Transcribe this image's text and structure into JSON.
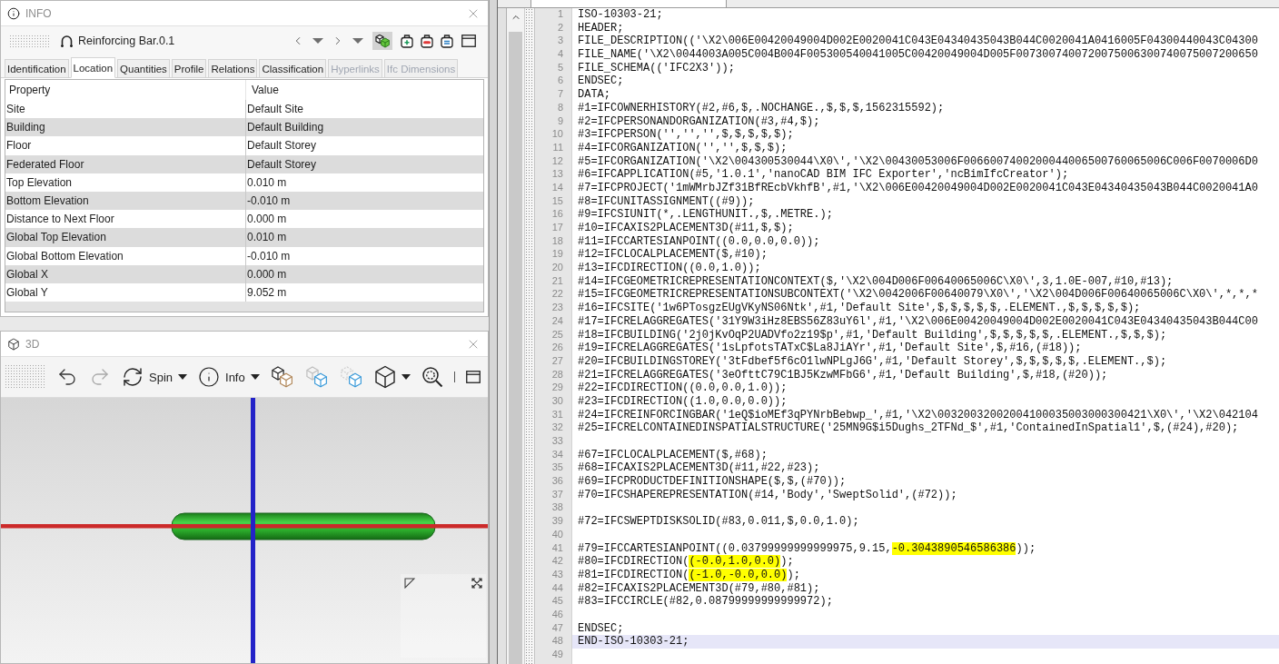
{
  "info_panel": {
    "title": "INFO",
    "object_name": "Reinforcing Bar.0.1",
    "toggle_on": true,
    "tabs": [
      {
        "label": "Identification",
        "selected": false,
        "disabled": false
      },
      {
        "label": "Location",
        "selected": true,
        "disabled": false
      },
      {
        "label": "Quantities",
        "selected": false,
        "disabled": false
      },
      {
        "label": "Profile",
        "selected": false,
        "disabled": false
      },
      {
        "label": "Relations",
        "selected": false,
        "disabled": false
      },
      {
        "label": "Classification",
        "selected": false,
        "disabled": false
      },
      {
        "label": "Hyperlinks",
        "selected": false,
        "disabled": true
      },
      {
        "label": "Ifc Dimensions",
        "selected": false,
        "disabled": true
      }
    ],
    "table": {
      "columns": [
        "Property",
        "Value"
      ],
      "rows": [
        {
          "property": "Site",
          "value": "Default Site"
        },
        {
          "property": "Building",
          "value": "Default Building"
        },
        {
          "property": "Floor",
          "value": "Default Storey"
        },
        {
          "property": "Federated Floor",
          "value": "Default Storey"
        },
        {
          "property": "Top Elevation",
          "value": "0.010 m"
        },
        {
          "property": "Bottom Elevation",
          "value": "-0.010 m"
        },
        {
          "property": "Distance to Next Floor",
          "value": "0.000 m"
        },
        {
          "property": "Global Top Elevation",
          "value": "0.010 m"
        },
        {
          "property": "Global Bottom Elevation",
          "value": "-0.010 m"
        },
        {
          "property": "Global X",
          "value": "0.000 m"
        },
        {
          "property": "Global Y",
          "value": "9.052 m"
        }
      ]
    }
  },
  "view_panel": {
    "title": "3D",
    "redo_disabled": true,
    "spin_label": "Spin",
    "info_label": "Info"
  },
  "editor": {
    "lines": [
      {
        "number": "1",
        "text": "ISO-10303-21;",
        "current": false
      },
      {
        "number": "2",
        "text": "HEADER;",
        "current": false
      },
      {
        "number": "3",
        "text": "FILE_DESCRIPTION(('\\X2\\006E00420049004D002E0020041C043E04340435043B044C0020041A0416005F04300440043C04300",
        "current": false
      },
      {
        "number": "4",
        "text": "FILE_NAME('\\X2\\0044003A005C004B004F005300540041005C00420049004D005F0073007400720075006300740075007200650",
        "current": false
      },
      {
        "number": "5",
        "text": "FILE_SCHEMA(('IFC2X3'));",
        "current": false
      },
      {
        "number": "6",
        "text": "ENDSEC;",
        "current": false
      },
      {
        "number": "7",
        "text": "DATA;",
        "current": false
      },
      {
        "number": "8",
        "text": "#1=IFCOWNERHISTORY(#2,#6,$,.NOCHANGE.,$,$,$,1562315592);",
        "current": false
      },
      {
        "number": "9",
        "text": "#2=IFCPERSONANDORGANIZATION(#3,#4,$);",
        "current": false
      },
      {
        "number": "10",
        "text": "#3=IFCPERSON('','','',$,$,$,$,$);",
        "current": false
      },
      {
        "number": "11",
        "text": "#4=IFCORGANIZATION('','',$,$,$);",
        "current": false
      },
      {
        "number": "12",
        "text": "#5=IFCORGANIZATION('\\X2\\004300530044\\X0\\','\\X2\\00430053006F0066007400200044006500760065006C006F0070006D0",
        "current": false
      },
      {
        "number": "13",
        "text": "#6=IFCAPPLICATION(#5,'1.0.1','nanoCAD BIM IFC Exporter','ncBimIfcCreator');",
        "current": false
      },
      {
        "number": "14",
        "text": "#7=IFCPROJECT('1mWMrbJZf31BfREcbVkhfB',#1,'\\X2\\006E00420049004D002E0020041C043E04340435043B044C0020041A0",
        "current": false
      },
      {
        "number": "15",
        "text": "#8=IFCUNITASSIGNMENT((#9));",
        "current": false
      },
      {
        "number": "16",
        "text": "#9=IFCSIUNIT(*,.LENGTHUNIT.,$,.METRE.);",
        "current": false
      },
      {
        "number": "17",
        "text": "#10=IFCAXIS2PLACEMENT3D(#11,$,$);",
        "current": false
      },
      {
        "number": "18",
        "text": "#11=IFCCARTESIANPOINT((0.0,0.0,0.0));",
        "current": false
      },
      {
        "number": "19",
        "text": "#12=IFCLOCALPLACEMENT($,#10);",
        "current": false
      },
      {
        "number": "20",
        "text": "#13=IFCDIRECTION((0.0,1.0));",
        "current": false
      },
      {
        "number": "21",
        "text": "#14=IFCGEOMETRICREPRESENTATIONCONTEXT($,'\\X2\\004D006F00640065006C\\X0\\',3,1.0E-007,#10,#13);",
        "current": false
      },
      {
        "number": "22",
        "text": "#15=IFCGEOMETRICREPRESENTATIONSUBCONTEXT('\\X2\\0042006F00640079\\X0\\','\\X2\\004D006F00640065006C\\X0\\',*,*,*",
        "current": false
      },
      {
        "number": "23",
        "text": "#16=IFCSITE('1w6PTosgzEUgVKyNS06Ntk',#1,'Default Site',$,$,$,$,$,.ELEMENT.,$,$,$,$,$);",
        "current": false
      },
      {
        "number": "24",
        "text": "#17=IFCRELAGGREGATES('31Y9W3iHz8EBS56Z83uY6l',#1,'\\X2\\006E00420049004D002E0020041C043E04340435043B044C00",
        "current": false
      },
      {
        "number": "25",
        "text": "#18=IFCBUILDING('2j0jKvOqP2UADVfo2z19$p',#1,'Default Building',$,$,$,$,$,.ELEMENT.,$,$,$);",
        "current": false
      },
      {
        "number": "26",
        "text": "#19=IFCRELAGGREGATES('1sLpfotsTATxC$La8JiAYr',#1,'Default Site',$,#16,(#18));",
        "current": false
      },
      {
        "number": "27",
        "text": "#20=IFCBUILDINGSTOREY('3tFdbef5f6cO1lwNPLgJ6G',#1,'Default Storey',$,$,$,$,$,.ELEMENT.,$);",
        "current": false
      },
      {
        "number": "28",
        "text": "#21=IFCRELAGGREGATES('3eOfttC79C1BJ5KzwMFbG6',#1,'Default Building',$,#18,(#20));",
        "current": false
      },
      {
        "number": "29",
        "text": "#22=IFCDIRECTION((0.0,0.0,1.0));",
        "current": false
      },
      {
        "number": "30",
        "text": "#23=IFCDIRECTION((1.0,0.0,0.0));",
        "current": false
      },
      {
        "number": "31",
        "text": "#24=IFCREINFORCINGBAR('1eQ$ioMEf3qPYNrbBebwp_',#1,'\\X2\\00320032002004100035003000300421\\X0\\','\\X2\\042104",
        "current": false
      },
      {
        "number": "32",
        "text": "#25=IFCRELCONTAINEDINSPATIALSTRUCTURE('25MN9G$i5Dughs_2TFNd_$',#1,'ContainedInSpatial1',$,(#24),#20);",
        "current": false
      },
      {
        "number": "33",
        "current": false
      },
      {
        "number": "34",
        "text": "#67=IFCLOCALPLACEMENT($,#68);",
        "current": false
      },
      {
        "number": "35",
        "text": "#68=IFCAXIS2PLACEMENT3D(#11,#22,#23);",
        "current": false
      },
      {
        "number": "36",
        "text": "#69=IFCPRODUCTDEFINITIONSHAPE($,$,(#70));",
        "current": false
      },
      {
        "number": "37",
        "text": "#70=IFCSHAPEREPRESENTATION(#14,'Body','SweptSolid',(#72));",
        "current": false
      },
      {
        "number": "38",
        "current": false
      },
      {
        "number": "39",
        "text": "#72=IFCSWEPTDISKSOLID(#83,0.011,$,0.0,1.0);",
        "current": false
      },
      {
        "number": "40",
        "current": false
      },
      {
        "number": "41",
        "segments": [
          {
            "text": "#79=IFCCARTESIANPOINT((0.03799999999999975,9.15,",
            "highlighted": false
          },
          {
            "text": "-0.3043890546586386",
            "highlighted": true
          },
          {
            "text": "));",
            "highlighted": false
          }
        ],
        "current": false
      },
      {
        "number": "42",
        "segments": [
          {
            "text": "#80=IFCDIRECTION(",
            "highlighted": false
          },
          {
            "text": "(-0.0,1.0,0.0)",
            "highlighted": true
          },
          {
            "text": ");",
            "highlighted": false
          }
        ],
        "current": false
      },
      {
        "number": "43",
        "segments": [
          {
            "text": "#81=IFCDIRECTION(",
            "highlighted": false
          },
          {
            "text": "(-1.0,-0.0,0.0)",
            "highlighted": true
          },
          {
            "text": ");",
            "highlighted": false
          }
        ],
        "current": false
      },
      {
        "number": "44",
        "text": "#82=IFCAXIS2PLACEMENT3D(#79,#80,#81);",
        "current": false
      },
      {
        "number": "45",
        "text": "#83=IFCCIRCLE(#82,0.08799999999999972);",
        "current": false
      },
      {
        "number": "46",
        "current": false
      },
      {
        "number": "47",
        "text": "ENDSEC;",
        "current": false
      },
      {
        "number": "48",
        "text": "END-ISO-10303-21;",
        "current": true
      },
      {
        "number": "49",
        "current": false
      }
    ]
  }
}
